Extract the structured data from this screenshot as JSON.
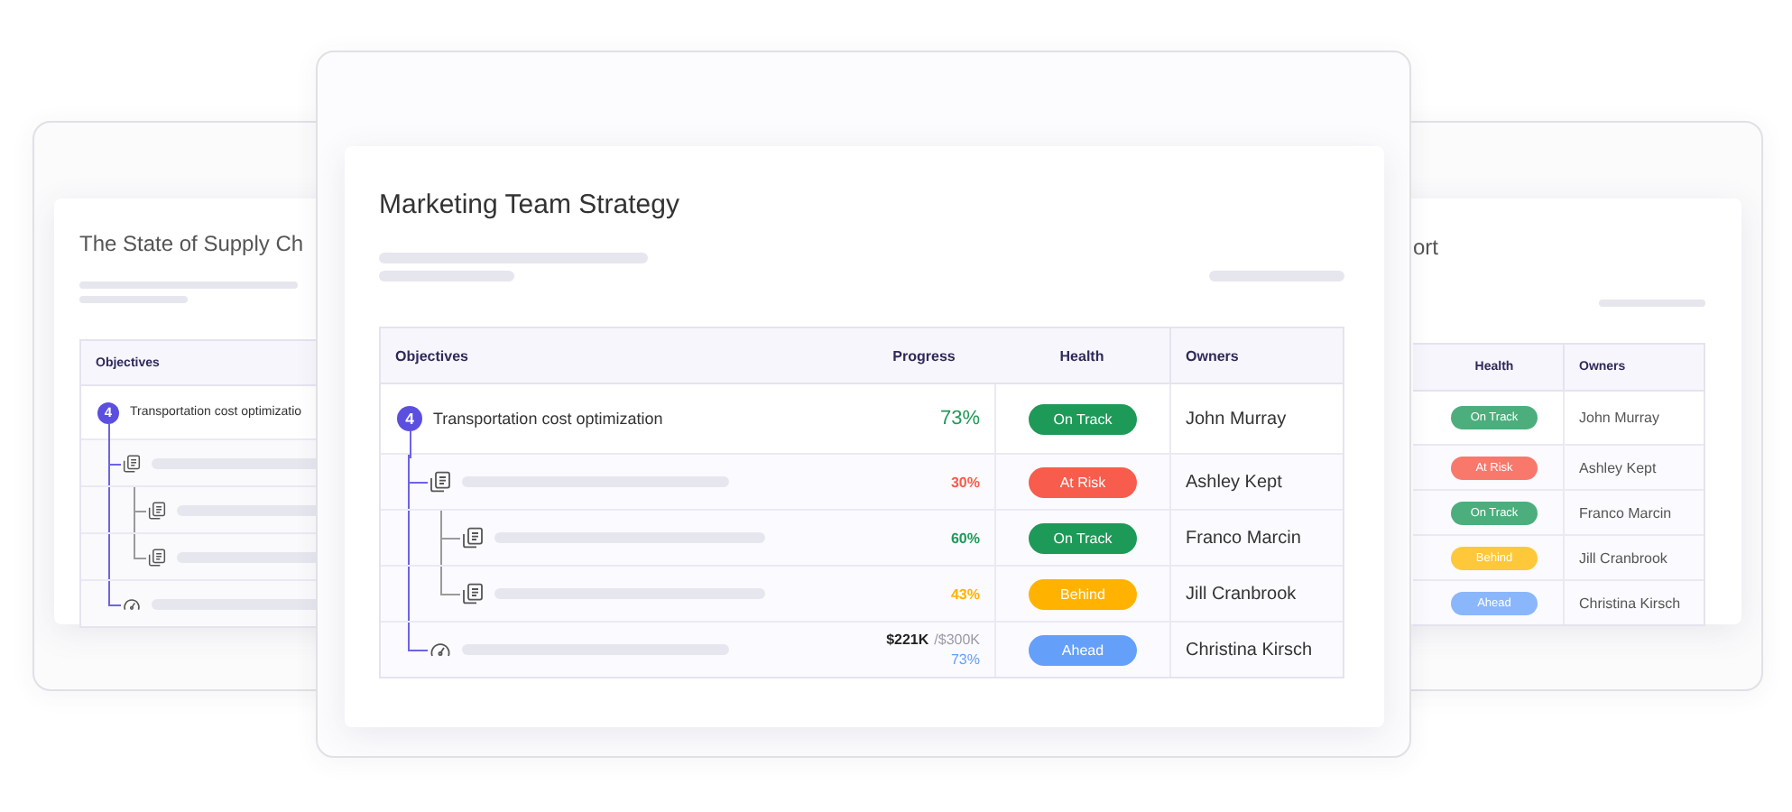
{
  "left_card": {
    "title": "The State of Supply Ch",
    "columns": [
      "Objectives"
    ],
    "rows": [
      {
        "kind": "objective",
        "count": "4",
        "title": "Transportation cost optimizatio",
        "children": [
          {
            "kind": "task",
            "children": [
              {
                "kind": "task"
              },
              {
                "kind": "task"
              }
            ]
          },
          {
            "kind": "metric"
          }
        ]
      }
    ]
  },
  "main_card": {
    "title": "Marketing Team Strategy",
    "columns": [
      "Objectives",
      "Progress",
      "Health",
      "Owners"
    ],
    "rows": [
      {
        "kind": "objective",
        "count": "4",
        "title": "Transportation cost optimization",
        "progress": "73%",
        "health": "On Track",
        "color": "#1e9a58",
        "owner": "John Murray",
        "children": [
          {
            "kind": "task",
            "progress": "30%",
            "health": "At Risk",
            "color": "#f85c4c",
            "owner": "Ashley Kept",
            "children": [
              {
                "kind": "task",
                "progress": "60%",
                "health": "On Track",
                "color": "#1e9a58",
                "owner": "Franco Marcin"
              },
              {
                "kind": "task",
                "progress": "43%",
                "health": "Behind",
                "color": "#ffb300",
                "owner": "Jill Cranbrook"
              }
            ]
          },
          {
            "kind": "metric",
            "amount": "$221K",
            "target": "/$300K",
            "progress": "73%",
            "health": "Ahead",
            "color": "#64a0fa",
            "owner": "Christina Kirsch"
          }
        ]
      }
    ]
  },
  "right_card": {
    "title": "ort",
    "columns": [
      "Health",
      "Owners"
    ],
    "rows": [
      {
        "health": "On Track",
        "color": "#4cae7c",
        "owner": "John Murray"
      },
      {
        "health": "At Risk",
        "color": "#f8786c",
        "owner": "Ashley Kept"
      },
      {
        "health": "On Track",
        "color": "#4cae7c",
        "owner": "Franco Marcin"
      },
      {
        "health": "Behind",
        "color": "#ffc83a",
        "owner": "Jill Cranbrook"
      },
      {
        "health": "Ahead",
        "color": "#8ab6fb",
        "owner": "Christina Kirsch"
      }
    ]
  }
}
